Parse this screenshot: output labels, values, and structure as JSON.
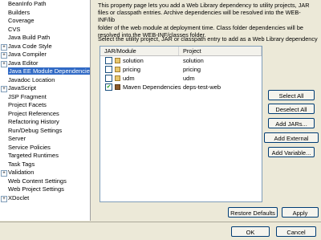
{
  "nav": {
    "items": [
      {
        "label": "BeanInfo Path",
        "expandable": false,
        "selected": false
      },
      {
        "label": "Builders",
        "expandable": false,
        "selected": false
      },
      {
        "label": "Coverage",
        "expandable": false,
        "selected": false
      },
      {
        "label": "CVS",
        "expandable": false,
        "selected": false
      },
      {
        "label": "Java Build Path",
        "expandable": false,
        "selected": false
      },
      {
        "label": "Java Code Style",
        "expandable": true,
        "selected": false
      },
      {
        "label": "Java Compiler",
        "expandable": true,
        "selected": false
      },
      {
        "label": "Java Editor",
        "expandable": true,
        "selected": false
      },
      {
        "label": "Java EE Module Dependencies",
        "expandable": false,
        "selected": true
      },
      {
        "label": "Javadoc Location",
        "expandable": false,
        "selected": false
      },
      {
        "label": "JavaScript",
        "expandable": true,
        "selected": false
      },
      {
        "label": "JSP Fragment",
        "expandable": false,
        "selected": false
      },
      {
        "label": "Project Facets",
        "expandable": false,
        "selected": false
      },
      {
        "label": "Project References",
        "expandable": false,
        "selected": false
      },
      {
        "label": "Refactoring History",
        "expandable": false,
        "selected": false
      },
      {
        "label": "Run/Debug Settings",
        "expandable": false,
        "selected": false
      },
      {
        "label": "Server",
        "expandable": false,
        "selected": false
      },
      {
        "label": "Service Policies",
        "expandable": false,
        "selected": false
      },
      {
        "label": "Targeted Runtimes",
        "expandable": false,
        "selected": false
      },
      {
        "label": "Task Tags",
        "expandable": false,
        "selected": false
      },
      {
        "label": "Validation",
        "expandable": true,
        "selected": false
      },
      {
        "label": "Web Content Settings",
        "expandable": false,
        "selected": false
      },
      {
        "label": "Web Project Settings",
        "expandable": false,
        "selected": false
      },
      {
        "label": "XDoclet",
        "expandable": true,
        "selected": false
      }
    ]
  },
  "description": {
    "line1": "This property page lets you add a Web Library dependency to utility projects, JAR",
    "line2": "files or classpath entries. Archive dependencies will be resolved into the WEB-INF/lib",
    "line3": "folder of the web module at deployment time. Class folder dependencies will be",
    "line4": "resolved into the WEB-INF/classes folder."
  },
  "prompt": "Select the utility project, JAR or classpath entry to add as a Web Library dependency",
  "table": {
    "headers": [
      "JAR/Module",
      "Project"
    ],
    "rows": [
      {
        "module": "solution",
        "project": "solution",
        "checked": false,
        "icon": "project-icon"
      },
      {
        "module": "pricing",
        "project": "pricing",
        "checked": false,
        "icon": "project-icon"
      },
      {
        "module": "udm",
        "project": "udm",
        "checked": false,
        "icon": "project-icon"
      },
      {
        "module": "Maven Dependencies",
        "project": "deps-test-web",
        "checked": true,
        "icon": "library-icon"
      }
    ]
  },
  "buttons": {
    "select_all": "Select All",
    "deselect_all": "Deselect All",
    "add_jars": "Add JARs...",
    "add_external_jars": "Add External JARs...",
    "add_variable": "Add Variable...",
    "restore_defaults": "Restore Defaults",
    "apply": "Apply",
    "ok": "OK",
    "cancel": "Cancel"
  },
  "colors": {
    "selection": "#316ac5",
    "dialog_bg": "#ece9d8",
    "check": "#21a121"
  }
}
